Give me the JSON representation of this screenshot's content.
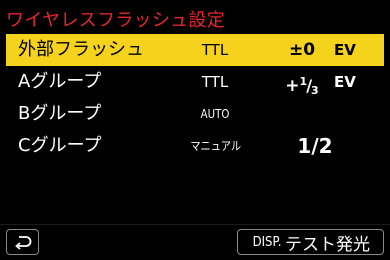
{
  "title": "ワイヤレスフラッシュ設定",
  "rows": [
    {
      "label": "外部フラッシュ",
      "mode": "TTL",
      "value": "±0",
      "unit": "EV",
      "selected": true
    },
    {
      "label": "Aグループ",
      "mode": "TTL",
      "value_prefix": "+",
      "value_numerator": "1",
      "value_denominator": "3",
      "unit": "EV"
    },
    {
      "label": "Bグループ",
      "mode": "AUTO"
    },
    {
      "label": "Cグループ",
      "mode": "マニュアル",
      "value": "1/2"
    }
  ],
  "footer": {
    "back_icon": "return-arrow-icon",
    "disp_key": "DISP.",
    "disp_label": "テスト発光"
  },
  "colors": {
    "title": "#e8262a",
    "selected_row": "#f5d21c",
    "background": "#000000"
  }
}
